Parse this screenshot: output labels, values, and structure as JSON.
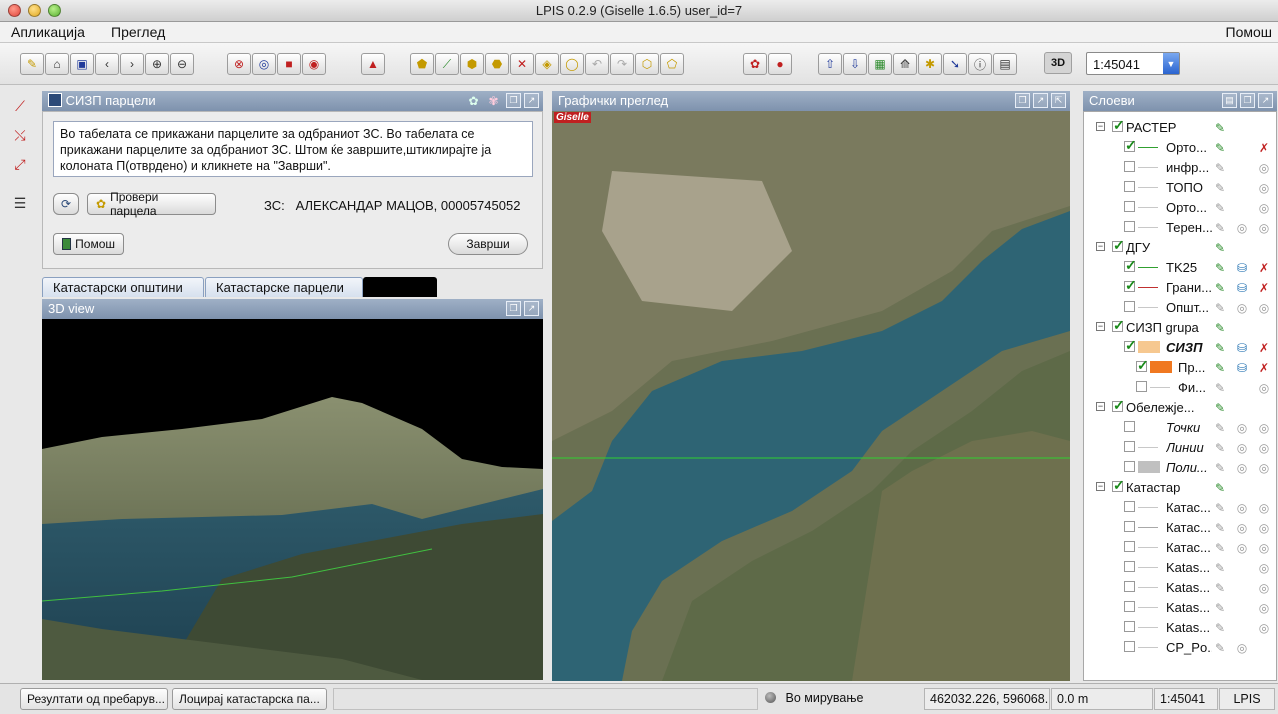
{
  "window": {
    "title": "LPIS 0.2.9 (Giselle 1.6.5) user_id=7"
  },
  "menu": {
    "app": "Апликација",
    "view": "Преглед",
    "help": "Помош"
  },
  "toolbar": {
    "three_d_label": "3D",
    "scale_value": "1:45041"
  },
  "sisp_panel": {
    "title": "СИЗП парцели",
    "info_text": "Во табелата се прикажани парцелите за одбраниот ЗС. Во табелата се прикажани парцелите за одбраниот ЗС. Штом ќе завршите,штиклирајте ја колоната П(отврдено) и кликнете на \"Заврши\".",
    "check_button": "Провери парцела",
    "zs_label": "ЗС:",
    "zs_value": "АЛЕКСАНДАР МАЦОВ, 00005745052",
    "help_button": "Помош",
    "finish_button": "Заврши"
  },
  "tabs": [
    "Катастарски општини",
    "Катастарске парцели"
  ],
  "view3d": {
    "title": "3D view"
  },
  "map": {
    "title": "Графички преглед",
    "watermark": "Giselle"
  },
  "layers": {
    "title": "Слоеви",
    "rows": [
      {
        "level": 0,
        "name": "РАСТЕР",
        "checked": true,
        "expanded": true,
        "icons": [
          "pen"
        ]
      },
      {
        "level": 1,
        "name": "Орто...",
        "checked": true,
        "sym": "line",
        "symcolor": "#30a030",
        "icons": [
          "pen",
          "",
          "x"
        ]
      },
      {
        "level": 1,
        "name": "инфр...",
        "checked": false,
        "sym": "line",
        "symcolor": "#c8c8c8",
        "icons": [
          "pen-g",
          "",
          "gr"
        ]
      },
      {
        "level": 1,
        "name": "ТОПО",
        "checked": false,
        "sym": "line",
        "symcolor": "#c8c8c8",
        "icons": [
          "pen-g",
          "",
          "gr"
        ]
      },
      {
        "level": 1,
        "name": "Орто...",
        "checked": false,
        "sym": "line",
        "symcolor": "#c8c8c8",
        "icons": [
          "pen-g",
          "",
          "gr"
        ]
      },
      {
        "level": 1,
        "name": "Терен...",
        "checked": false,
        "sym": "line",
        "symcolor": "#c8c8c8",
        "icons": [
          "pen-g",
          "gr",
          "gr"
        ]
      },
      {
        "level": 0,
        "name": "ДГУ",
        "checked": true,
        "expanded": true,
        "icons": [
          "pen"
        ]
      },
      {
        "level": 1,
        "name": "TK25",
        "checked": true,
        "sym": "line",
        "symcolor": "#30a030",
        "icons": [
          "pen",
          "db",
          "x"
        ]
      },
      {
        "level": 1,
        "name": "Грани...",
        "checked": true,
        "sym": "line",
        "symcolor": "#c03030",
        "icons": [
          "pen",
          "db",
          "x"
        ]
      },
      {
        "level": 1,
        "name": "Општ...",
        "checked": false,
        "sym": "line",
        "symcolor": "#c8c8c8",
        "icons": [
          "pen-g",
          "gr",
          "gr"
        ]
      },
      {
        "level": 0,
        "name": "СИЗП grupa",
        "checked": true,
        "expanded": true,
        "icons": [
          "pen"
        ]
      },
      {
        "level": 1,
        "name": "СИЗП",
        "checked": true,
        "sym": "swatch",
        "symcolor": "#f6c890",
        "bolditalic": true,
        "icons": [
          "pen",
          "db",
          "x"
        ]
      },
      {
        "level": 2,
        "name": "Пр...",
        "checked": true,
        "sym": "swatch",
        "symcolor": "#f07820",
        "icons": [
          "pen",
          "db",
          "x"
        ]
      },
      {
        "level": 2,
        "name": "Фи...",
        "checked": false,
        "sym": "line",
        "symcolor": "#c8c8c8",
        "icons": [
          "pen-g",
          "",
          "gr"
        ]
      },
      {
        "level": 0,
        "name": "Обележје...",
        "checked": true,
        "expanded": true,
        "icons": [
          "pen"
        ]
      },
      {
        "level": 1,
        "name": "Точки",
        "checked": false,
        "sym": "none",
        "italic": true,
        "icons": [
          "pen-g",
          "gr",
          "gr"
        ]
      },
      {
        "level": 1,
        "name": "Линии",
        "checked": false,
        "sym": "line",
        "symcolor": "#c8c8c8",
        "italic": true,
        "icons": [
          "pen-g",
          "gr",
          "gr"
        ]
      },
      {
        "level": 1,
        "name": "Поли...",
        "checked": false,
        "sym": "swatch",
        "symcolor": "#c0c0c0",
        "italic": true,
        "icons": [
          "pen-g",
          "gr",
          "gr"
        ]
      },
      {
        "level": 0,
        "name": "Катастар",
        "checked": true,
        "expanded": true,
        "icons": [
          "pen"
        ]
      },
      {
        "level": 1,
        "name": "Катас...",
        "checked": false,
        "sym": "line",
        "symcolor": "#c8c8c8",
        "icons": [
          "pen-g",
          "gr",
          "gr"
        ]
      },
      {
        "level": 1,
        "name": "Катас...",
        "checked": false,
        "sym": "line",
        "symcolor": "#a8a8a8",
        "icons": [
          "pen-g",
          "gr",
          "gr"
        ]
      },
      {
        "level": 1,
        "name": "Катас...",
        "checked": false,
        "sym": "line",
        "symcolor": "#c8c8c8",
        "icons": [
          "pen-g",
          "gr",
          "gr"
        ]
      },
      {
        "level": 1,
        "name": "Katas...",
        "checked": false,
        "sym": "line",
        "symcolor": "#c8c8c8",
        "icons": [
          "pen-g",
          "",
          "gr"
        ]
      },
      {
        "level": 1,
        "name": "Katas...",
        "checked": false,
        "sym": "line",
        "symcolor": "#c8c8c8",
        "icons": [
          "pen-g",
          "",
          "gr"
        ]
      },
      {
        "level": 1,
        "name": "Katas...",
        "checked": false,
        "sym": "line",
        "symcolor": "#c8c8c8",
        "icons": [
          "pen-g",
          "",
          "gr"
        ]
      },
      {
        "level": 1,
        "name": "Katas...",
        "checked": false,
        "sym": "line",
        "symcolor": "#c8c8c8",
        "icons": [
          "pen-g",
          "",
          "gr"
        ]
      },
      {
        "level": 1,
        "name": "CP_Po...",
        "checked": false,
        "sym": "line",
        "symcolor": "#c8c8c8",
        "icons": [
          "pen-g",
          "gr",
          ""
        ]
      }
    ]
  },
  "statusbar": {
    "task1": "Резултати од пребарув...",
    "task2": "Лоцирај катастарска па...",
    "status": "Во мирување",
    "coords": "462032.226, 596068....",
    "distance": "0.0 m",
    "scale": "1:45041",
    "app": "LPIS"
  }
}
